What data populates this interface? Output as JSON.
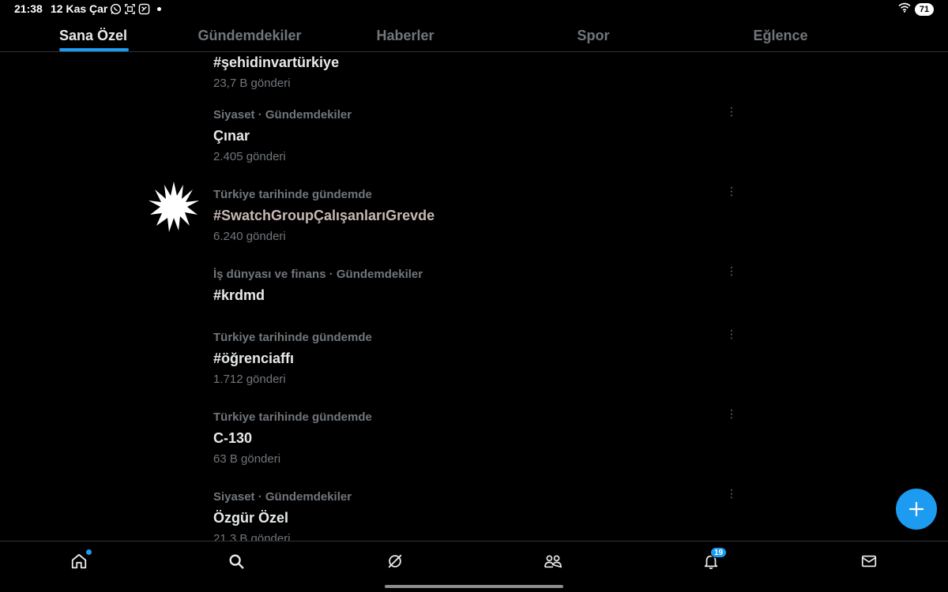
{
  "status_bar": {
    "time": "21:38",
    "date": "12 Kas Çar",
    "battery": "71",
    "icons": [
      "whatsapp-icon",
      "screenshot-icon",
      "app-icon"
    ]
  },
  "tabs": [
    {
      "label": "Sana Özel",
      "active": true
    },
    {
      "label": "Gündemdekiler",
      "active": false
    },
    {
      "label": "Haberler",
      "active": false
    },
    {
      "label": "Spor",
      "active": false
    },
    {
      "label": "Eğlence",
      "active": false
    }
  ],
  "trends": [
    {
      "meta": "",
      "title": "#şehidinvartürkiye",
      "count": "23,7 B gönderi",
      "promoted": false
    },
    {
      "meta": "Siyaset · Gündemdekiler",
      "title": "Çınar",
      "count": "2.405 gönderi",
      "promoted": false
    },
    {
      "meta": "Türkiye tarihinde gündemde",
      "title": "#SwatchGroupÇalışanlarıGrevde",
      "count": "6.240 gönderi",
      "promoted": true
    },
    {
      "meta": "İş dünyası ve finans · Gündemdekiler",
      "title": "#krdmd",
      "count": "",
      "promoted": false
    },
    {
      "meta": "Türkiye tarihinde gündemde",
      "title": "#öğrenciaffı",
      "count": "1.712 gönderi",
      "promoted": false
    },
    {
      "meta": "Türkiye tarihinde gündemde",
      "title": "C-130",
      "count": "63 B gönderi",
      "promoted": false
    },
    {
      "meta": "Siyaset · Gündemdekiler",
      "title": "Özgür Özel",
      "count": "21,3 B gönderi",
      "promoted": false
    }
  ],
  "more_icon": "⋮",
  "fab_icon": "plus-icon",
  "nav": {
    "items": [
      "home-icon",
      "search-icon",
      "grok-icon",
      "communities-icon",
      "notifications-icon",
      "messages-icon"
    ],
    "notifications_badge": "19"
  },
  "colors": {
    "accent": "#1d9bf0",
    "text_primary": "#e7e9ea",
    "text_secondary": "#71767b",
    "background": "#000000"
  }
}
